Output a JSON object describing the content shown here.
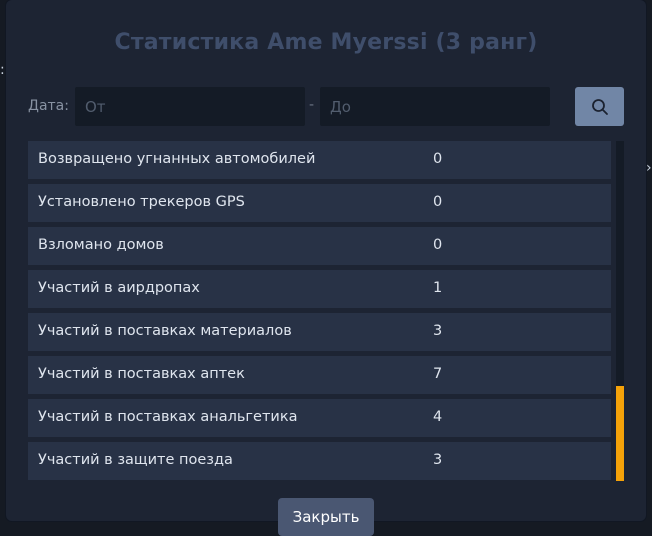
{
  "dialog": {
    "title": "Статистика Ame Myerssi (3 ранг)",
    "date_label": "Дата:",
    "from_placeholder": "От",
    "to_placeholder": "До",
    "dash": "-",
    "search_icon": "search-icon",
    "close_label": "Закрыть"
  },
  "stats": [
    {
      "label": "Возвращено угнанных автомобилей",
      "value": "0"
    },
    {
      "label": "Установлено трекеров GPS",
      "value": "0"
    },
    {
      "label": "Взломано домов",
      "value": "0"
    },
    {
      "label": "Участий в аирдропах",
      "value": "1"
    },
    {
      "label": "Участий в поставках материалов",
      "value": "3"
    },
    {
      "label": "Участий в поставках аптек",
      "value": "7"
    },
    {
      "label": "Участий в поставках анальгетика",
      "value": "4"
    },
    {
      "label": "Участий в защите поезда",
      "value": "3"
    }
  ],
  "scroll": {
    "position": 0.72,
    "visible_fraction": 0.28
  },
  "colors": {
    "background": "#151a23",
    "panel": "#1d2433",
    "row": "#283246",
    "title": "#3f4e6b",
    "accent_scrollbar": "#f5a209",
    "search_button": "#7186a6"
  }
}
